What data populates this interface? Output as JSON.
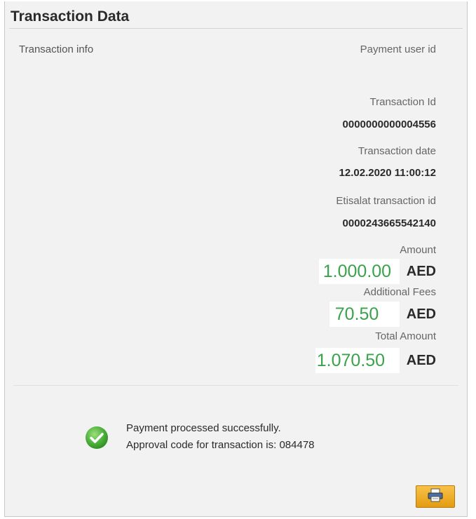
{
  "title": "Transaction Data",
  "transaction_info_label": "Transaction info",
  "payment_user_id_label": "Payment user id",
  "transaction_id": {
    "label": "Transaction Id",
    "value": "0000000000004556"
  },
  "transaction_date": {
    "label": "Transaction date",
    "value": "12.02.2020 11:00:12"
  },
  "etisalat_transaction_id": {
    "label": "Etisalat transaction id",
    "value": "0000243665542140"
  },
  "amount": {
    "label": "Amount",
    "value": "1.000.00",
    "currency": "AED"
  },
  "additional_fees": {
    "label": "Additional Fees",
    "value": "70.50",
    "currency": "AED"
  },
  "total_amount": {
    "label": "Total Amount",
    "value": "1.070.50",
    "currency": "AED"
  },
  "status": {
    "line1": "Payment processed successfully.",
    "line2": "Approval code for transaction is: 084478",
    "icon": "check-circle-icon"
  },
  "print_button": {
    "icon": "printer-icon"
  },
  "colors": {
    "amount_green": "#3aa34a",
    "success_green": "#4caf3a",
    "print_button_orange": "#f0ac26"
  }
}
